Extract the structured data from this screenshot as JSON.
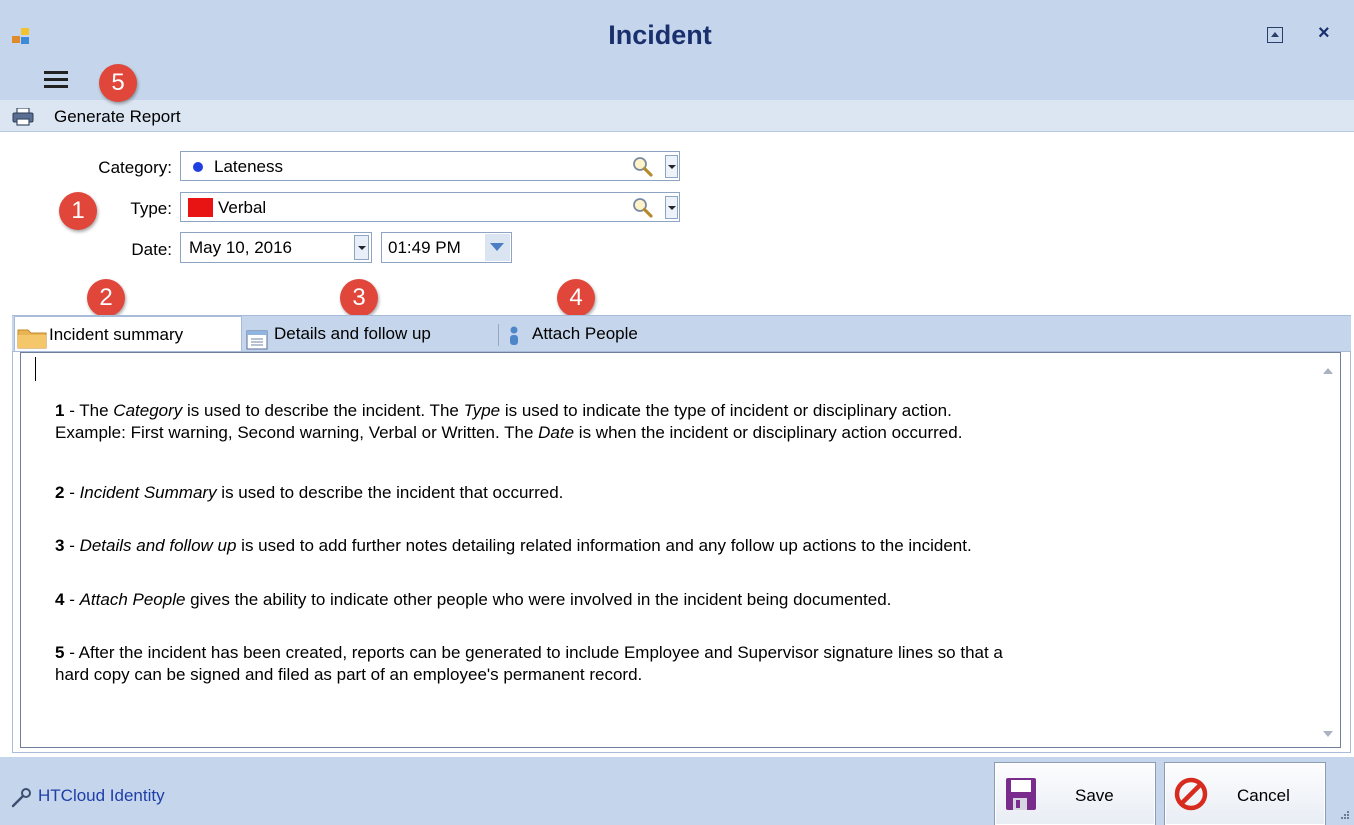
{
  "window": {
    "title": "Incident",
    "restore_label": "restore-window",
    "close_glyph": "×"
  },
  "badges": [
    "1",
    "2",
    "3",
    "4",
    "5"
  ],
  "toolbar": {
    "generate_report": "Generate Report"
  },
  "form": {
    "category_label": "Category:",
    "category_value": "Lateness",
    "type_label": "Type:",
    "type_value": "Verbal",
    "date_label": "Date:",
    "date_value": "May 10, 2016",
    "time_value": "01:49 PM"
  },
  "tabs": [
    {
      "label": "Incident summary",
      "active": true
    },
    {
      "label": "Details and follow up",
      "active": false
    },
    {
      "label": "Attach People",
      "active": false
    }
  ],
  "content": {
    "p1": {
      "num": "1",
      "t1": " - The ",
      "e1": "Category",
      "t2": " is used to describe the incident. The ",
      "e2": "Type",
      "t3": " is used to indicate the type of incident or disciplinary action.",
      "t4": "Example: First warning, Second warning, Verbal or Written. The ",
      "e3": "Date",
      "t5": " is when the incident or disciplinary action occurred."
    },
    "p2": {
      "num": "2",
      "t1": " - ",
      "e1": "Incident Summary",
      "t2": " is used to describe the incident that occurred."
    },
    "p3": {
      "num": "3",
      "t1": " - ",
      "e1": "Details and follow up",
      "t2": " is used to add further notes detailing related information and any follow up actions to the incident."
    },
    "p4": {
      "num": "4",
      "t1": " - ",
      "e1": "Attach People",
      "t2": " gives the ability to indicate other people who were involved in the incident being documented."
    },
    "p5": {
      "num": "5",
      "t1": " - After the incident has been created, reports can be generated to include Employee and Supervisor signature lines so that a",
      "t2": "hard copy can be signed and filed as part of an employee's permanent record."
    }
  },
  "footer": {
    "identity": "HTCloud Identity",
    "save": "Save",
    "cancel": "Cancel"
  },
  "colors": {
    "chrome": "#c5d6ec",
    "badge": "#e0463a",
    "title": "#1a2f6e",
    "type_swatch": "#e81414",
    "category_dot": "#1f3fe0"
  }
}
